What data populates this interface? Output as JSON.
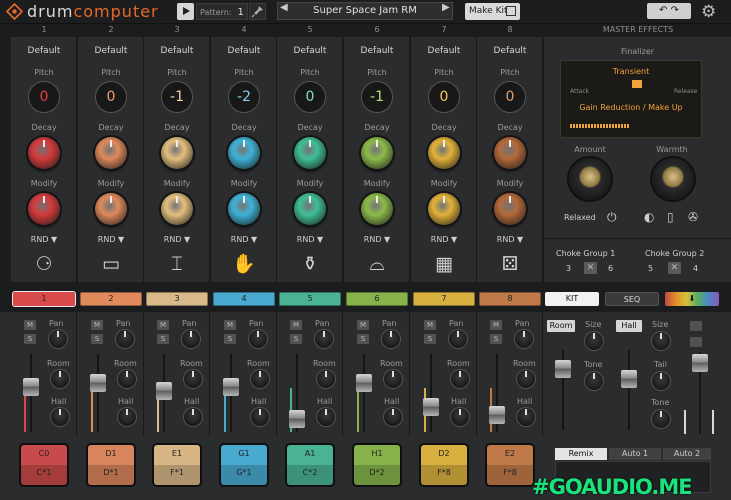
{
  "header": {
    "title_a": "drum",
    "title_b": "computer",
    "pattern_label": "Pattern:",
    "pattern_value": "1",
    "preset_name": "Super Space Jam RM",
    "make_kit_label": "Make Kit"
  },
  "master": {
    "title": "MASTER EFFECTS",
    "finalizer": "Finalizer",
    "transient": "Transient",
    "attack": "Attack",
    "release": "Release",
    "gain_reduction": "Gain Reduction / Make Up",
    "amount": "Amount",
    "warmth": "Warmth",
    "relaxed": "Relaxed",
    "choke1": {
      "label": "Choke Group 1",
      "a": "3",
      "b": "6"
    },
    "choke2": {
      "label": "Choke Group 2",
      "a": "5",
      "b": "4"
    }
  },
  "labels": {
    "default": "Default",
    "pitch": "Pitch",
    "decay": "Decay",
    "modify": "Modify",
    "rnd": "RND ▼",
    "m": "M",
    "s": "S",
    "pan": "Pan",
    "room": "Room",
    "hall": "Hall"
  },
  "channels": [
    {
      "num": "1",
      "pitch": "0",
      "pitch_color": "#e54040",
      "decay_color": "#d43b3b",
      "modify_color": "#d43b3b",
      "tab_color": "#d94a4a",
      "pad_top": "C0",
      "pad_bottom": "C*1",
      "pad_color": "#c94a4a",
      "icon": "⚆",
      "icon_name": "kick-drum-icon"
    },
    {
      "num": "2",
      "pitch": "0",
      "pitch_color": "#f0a070",
      "decay_color": "#e08a5c",
      "modify_color": "#e08a5c",
      "tab_color": "#e08a5c",
      "pad_top": "D1",
      "pad_bottom": "D*1",
      "pad_color": "#d8845c",
      "icon": "▭",
      "icon_name": "snare-drum-icon"
    },
    {
      "num": "3",
      "pitch": "-1",
      "pitch_color": "#f0d7a4",
      "decay_color": "#e3bf7e",
      "modify_color": "#e3bf7e",
      "tab_color": "#d9b98a",
      "pad_top": "E1",
      "pad_bottom": "F*1",
      "pad_color": "#d7b585",
      "icon": "⌶",
      "icon_name": "hihat-icon"
    },
    {
      "num": "4",
      "pitch": "-2",
      "pitch_color": "#7fd6ee",
      "decay_color": "#3fb3d9",
      "modify_color": "#3fb3d9",
      "tab_color": "#4aa9cf",
      "pad_top": "G1",
      "pad_bottom": "G*1",
      "pad_color": "#4aa9cf",
      "icon": "✋",
      "icon_name": "clap-icon"
    },
    {
      "num": "5",
      "pitch": "0",
      "pitch_color": "#7fe0c0",
      "decay_color": "#3fbf97",
      "modify_color": "#3fbf97",
      "tab_color": "#4ab393",
      "pad_top": "A1",
      "pad_bottom": "C*2",
      "pad_color": "#4ab393",
      "icon": "⚱",
      "icon_name": "conga-icon"
    },
    {
      "num": "6",
      "pitch": "-1",
      "pitch_color": "#b6e07a",
      "decay_color": "#8dbb4a",
      "modify_color": "#8dbb4a",
      "tab_color": "#86b24c",
      "pad_top": "H1",
      "pad_bottom": "D*2",
      "pad_color": "#86b24c",
      "icon": "⌓",
      "icon_name": "cymbal-icon"
    },
    {
      "num": "7",
      "pitch": "0",
      "pitch_color": "#f5cc5a",
      "decay_color": "#e4b23a",
      "modify_color": "#e4b23a",
      "tab_color": "#d8b040",
      "pad_top": "D2",
      "pad_bottom": "F*8",
      "pad_color": "#d8b040",
      "icon": "▦",
      "icon_name": "keyboard-icon"
    },
    {
      "num": "8",
      "pitch": "0",
      "pitch_color": "#e0a070",
      "decay_color": "#b56a3a",
      "modify_color": "#b56a3a",
      "tab_color": "#c07a4a",
      "pad_top": "E2",
      "pad_bottom": "F*8",
      "pad_color": "#c07a4a",
      "icon": "⚄",
      "icon_name": "dice-icon"
    }
  ],
  "tabs": {
    "kit": "KIT",
    "seq": "SEQ",
    "arrow": "⬇"
  },
  "fx": {
    "room": "Room",
    "hall": "Hall",
    "size": "Size",
    "tone": "Tone",
    "tail": "Tail"
  },
  "remix": {
    "remix": "Remix",
    "auto1": "Auto 1",
    "auto2": "Auto 2"
  },
  "watermark": "#GOAUDIO.ME",
  "colors": {
    "accent": "#e9682b",
    "amber": "#f0a33b",
    "watermark": "#19e37a"
  }
}
